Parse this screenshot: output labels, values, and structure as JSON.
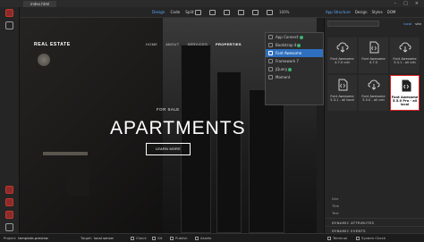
{
  "titlebar": {
    "tab": "index.html"
  },
  "toolbar": {
    "views": [
      "Design",
      "Code",
      "Split"
    ],
    "active_view": "Design",
    "zoom": "100%"
  },
  "panel_tabs": [
    "App Structure",
    "Design",
    "Styles",
    "DOM"
  ],
  "panel_links": [
    "local",
    "site"
  ],
  "site": {
    "brand": "REAL ESTATE",
    "nav": [
      "HOME",
      "ABOUT",
      "SERVICES",
      "PROPERTIES"
    ],
    "eyebrow": "FOR SALE",
    "heading": "APARTMENTS",
    "button": "LEARN MORE"
  },
  "framework_list": [
    {
      "label": "App Connect",
      "badge": true,
      "selected": false
    },
    {
      "label": "Bootstrap 4",
      "badge": true,
      "selected": false
    },
    {
      "label": "Font Awesome",
      "badge": false,
      "selected": true
    },
    {
      "label": "Framework 7",
      "badge": false,
      "selected": false
    },
    {
      "label": "jQuery",
      "badge": true,
      "selected": false
    },
    {
      "label": "Moment",
      "badge": false,
      "selected": false
    }
  ],
  "libraries": [
    {
      "title": "Font Awesome 4.7.0 cdn",
      "icon": "cloud-download-icon",
      "selected": false
    },
    {
      "title": "Font Awesome 4.7.0",
      "icon": "file-code-icon",
      "selected": false
    },
    {
      "title": "Font Awesome 5.3.1 - all cdn",
      "icon": "cloud-download-icon",
      "selected": false
    },
    {
      "title": "Font Awesome 5.3.1 - all local",
      "icon": "file-code-icon",
      "selected": false
    },
    {
      "title": "Font Awesome 5.5.0 - all cdn",
      "icon": "cloud-download-icon",
      "selected": false
    },
    {
      "title": "Font Awesome 5.5.0 Pro - all local",
      "icon": "file-code-icon",
      "selected": true
    }
  ],
  "properties": {
    "rows": [
      "title",
      "Title",
      "Text"
    ],
    "sections": [
      "DYNAMIC ATTRIBUTES",
      "DYNAMIC EVENTS"
    ]
  },
  "status": {
    "project_label": "Project:",
    "project": "template-preview",
    "target_label": "Target:",
    "target": "local server",
    "items": [
      "Check",
      "Git",
      "Publish",
      "Assets"
    ],
    "right": [
      "Terminal",
      "System Check"
    ]
  },
  "colors": {
    "accent": "#5aa9ff",
    "selection": "#2f6fbf",
    "highlight_border": "#dd2222"
  }
}
